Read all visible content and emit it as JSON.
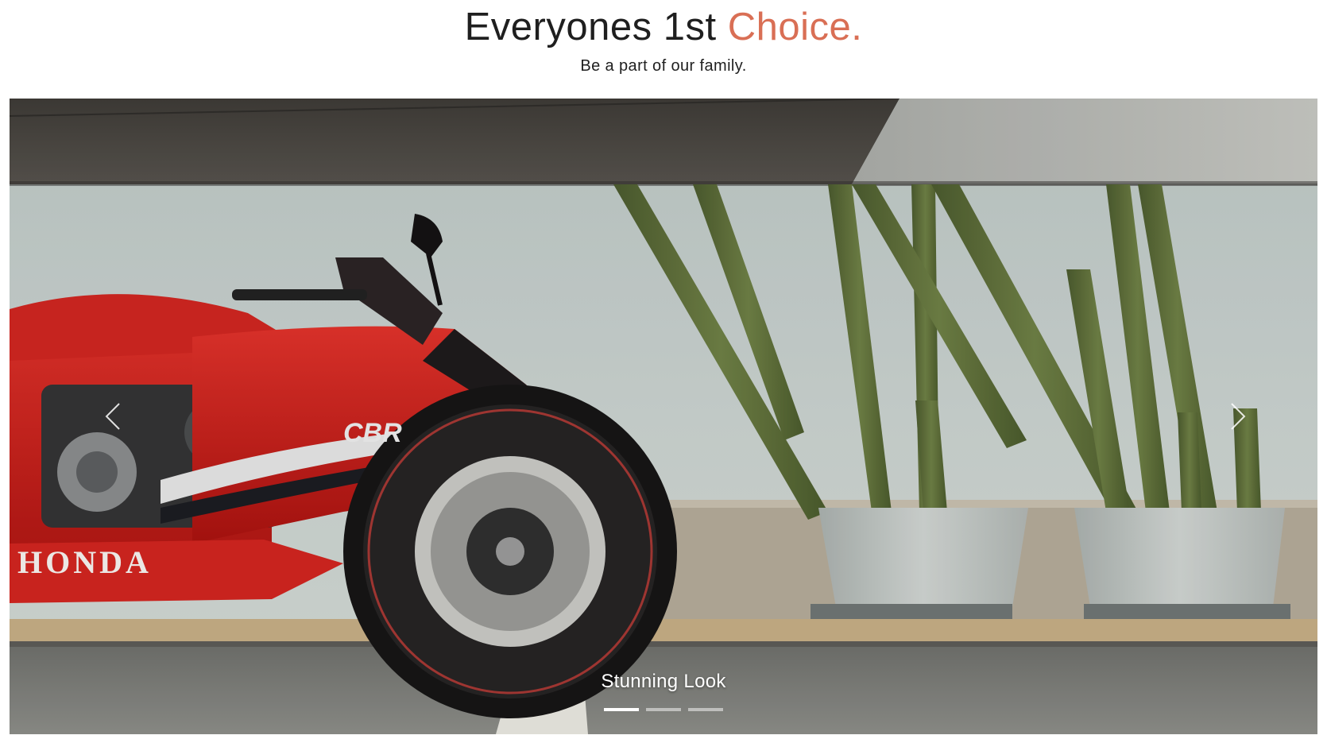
{
  "header": {
    "title_main": "Everyones 1st ",
    "title_accent": "Choice.",
    "subtitle": "Be a part of our family.",
    "accent_color": "#d96f55"
  },
  "carousel": {
    "slide_image": "red-honda-motorcycle-cactus-pots",
    "caption": "Stunning Look",
    "brand_text": "HONDA",
    "model_text": "CBR",
    "prev_icon": "chevron-left-icon",
    "next_icon": "chevron-right-icon",
    "slide_count": 3,
    "active_slide": 1
  }
}
